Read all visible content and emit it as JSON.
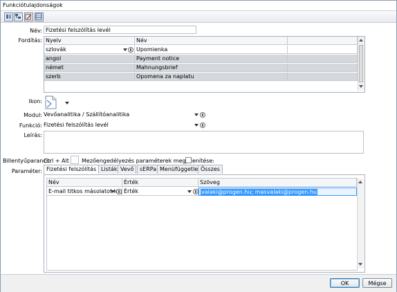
{
  "window": {
    "title": "Funkciótulajdonságok"
  },
  "toolbar": {
    "icons": [
      "cut-icon",
      "tree-icon",
      "edit-icon",
      "table-icon"
    ]
  },
  "form": {
    "nev_label": "Név:",
    "nev_value": "Fizetési felszólítás levél",
    "forditas_label": "Fordítás:",
    "translation_headers": [
      "Nyelv",
      "Név"
    ],
    "translations": [
      {
        "lang": "szlovák",
        "name": "Upomienka"
      },
      {
        "lang": "angol",
        "name": "Payment notice"
      },
      {
        "lang": "német",
        "name": "Mahnungsbrief"
      },
      {
        "lang": "szerb",
        "name": "Opomena za naplatu"
      }
    ],
    "ikon_label": "Ikon:",
    "modul_label": "Modul:",
    "modul_value": "Vevőanalitika / Szállítóanalitika",
    "funkcio_label": "Funkció:",
    "funkcio_value": "Fizetési felszólítás levél",
    "leiras_label": "Leírás:",
    "leiras_value": "",
    "shortcut_label": "Billentyűparancs:",
    "shortcut_value": "Ctrl + Alt +",
    "shortcut_key": "",
    "approval_label": "Mezőengedélyezés paraméterek megjelenítése:",
    "approval_checked": false,
    "parameter_label": "Paraméter:"
  },
  "param_tabs": [
    "Fizetési felszólítás levél",
    "Listák",
    "Vevő",
    "sERPa",
    "Menüfüggetlen",
    "Összes"
  ],
  "param_grid": {
    "headers": [
      "Név",
      "Érték",
      "Szöveg"
    ],
    "rows": [
      {
        "name": "E-mail titkos másolatot kap",
        "value": "Érték",
        "text": "valaki@progen.hu; masvalaki@progen.hu"
      }
    ]
  },
  "footer": {
    "ok_label": "OK",
    "cancel_label": "Mégse"
  }
}
